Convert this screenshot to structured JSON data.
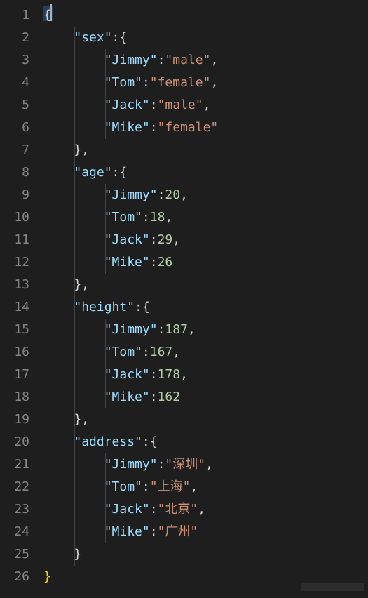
{
  "editor": {
    "language": "json",
    "theme": "dark",
    "line_count": 26,
    "line_numbers": [
      "1",
      "2",
      "3",
      "4",
      "5",
      "6",
      "7",
      "8",
      "9",
      "10",
      "11",
      "12",
      "13",
      "14",
      "15",
      "16",
      "17",
      "18",
      "19",
      "20",
      "21",
      "22",
      "23",
      "24",
      "25",
      "26"
    ],
    "indent_guides": true,
    "colors": {
      "background": "#1e1e1e",
      "gutter_fg": "#858585",
      "property": "#9cdcfe",
      "string": "#ce9178",
      "number": "#b5cea8",
      "punctuation": "#d4d4d4",
      "indent_guide": "#404040",
      "match_brace": "#ffd700"
    }
  },
  "code": {
    "l1": {
      "open": "{"
    },
    "l2": {
      "k": "\"sex\"",
      "c": ":",
      "open": "{"
    },
    "l3": {
      "k": "\"Jimmy\"",
      "c": ":",
      "v": "\"male\"",
      "t": ","
    },
    "l4": {
      "k": "\"Tom\"",
      "c": ":",
      "v": "\"female\"",
      "t": ","
    },
    "l5": {
      "k": "\"Jack\"",
      "c": ":",
      "v": "\"male\"",
      "t": ","
    },
    "l6": {
      "k": "\"Mike\"",
      "c": ":",
      "v": "\"female\""
    },
    "l7": {
      "close": "}",
      "t": ","
    },
    "l8": {
      "k": "\"age\"",
      "c": ":",
      "open": "{"
    },
    "l9": {
      "k": "\"Jimmy\"",
      "c": ":",
      "v": "20",
      "t": ","
    },
    "l10": {
      "k": "\"Tom\"",
      "c": ":",
      "v": "18",
      "t": ","
    },
    "l11": {
      "k": "\"Jack\"",
      "c": ":",
      "v": "29",
      "t": ","
    },
    "l12": {
      "k": "\"Mike\"",
      "c": ":",
      "v": "26"
    },
    "l13": {
      "close": "}",
      "t": ","
    },
    "l14": {
      "k": "\"height\"",
      "c": ":",
      "open": "{"
    },
    "l15": {
      "k": "\"Jimmy\"",
      "c": ":",
      "v": "187",
      "t": ","
    },
    "l16": {
      "k": "\"Tom\"",
      "c": ":",
      "v": "167",
      "t": ","
    },
    "l17": {
      "k": "\"Jack\"",
      "c": ":",
      "v": "178",
      "t": ","
    },
    "l18": {
      "k": "\"Mike\"",
      "c": ":",
      "v": "162"
    },
    "l19": {
      "close": "}",
      "t": ","
    },
    "l20": {
      "k": "\"address\"",
      "c": ":",
      "open": "{"
    },
    "l21": {
      "k": "\"Jimmy\"",
      "c": ":",
      "v": "\"深圳\"",
      "t": ","
    },
    "l22": {
      "k": "\"Tom\"",
      "c": ":",
      "v": "\"上海\"",
      "t": ","
    },
    "l23": {
      "k": "\"Jack\"",
      "c": ":",
      "v": "\"北京\"",
      "t": ","
    },
    "l24": {
      "k": "\"Mike\"",
      "c": ":",
      "v": "\"广州\""
    },
    "l25": {
      "close": "}"
    },
    "l26": {
      "close": "}"
    }
  },
  "indent": {
    "i0": "",
    "i1": "    ",
    "i2": "        ",
    "guide1": "    ",
    "guide2": "        "
  }
}
